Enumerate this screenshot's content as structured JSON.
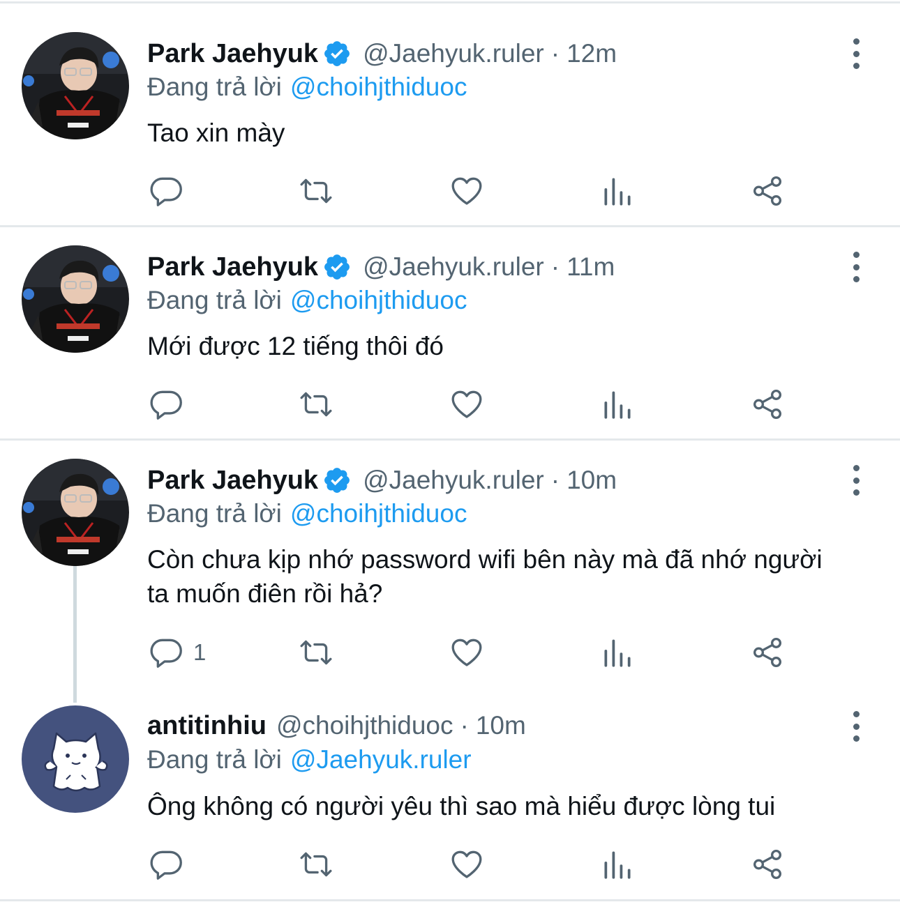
{
  "tweets": [
    {
      "name": "Park Jaehyuk",
      "verified": true,
      "handle": "@Jaehyuk.ruler",
      "dot": "·",
      "time": "12m",
      "reply_prefix": "Đang trả lời",
      "reply_to": "@choihjthiduoc",
      "text": "Tao xin mày",
      "reply_count": ""
    },
    {
      "name": "Park Jaehyuk",
      "verified": true,
      "handle": "@Jaehyuk.ruler",
      "dot": "·",
      "time": "11m",
      "reply_prefix": "Đang trả lời",
      "reply_to": "@choihjthiduoc",
      "text": "Mới được 12 tiếng thôi đó",
      "reply_count": ""
    },
    {
      "name": "Park Jaehyuk",
      "verified": true,
      "handle": "@Jaehyuk.ruler",
      "dot": "·",
      "time": "10m",
      "reply_prefix": "Đang trả lời",
      "reply_to": "@choihjthiduoc",
      "text": "Còn chưa kịp nhớ password wifi bên này mà đã nhớ người ta muốn điên rồi hả?",
      "reply_count": "1"
    },
    {
      "name": "antitinhiu",
      "verified": false,
      "handle": "@choihjthiduoc",
      "dot": "·",
      "time": "10m",
      "reply_prefix": "Đang trả lời",
      "reply_to": "@Jaehyuk.ruler",
      "text": "Ông không có người yêu thì sao mà hiểu được lòng tui",
      "reply_count": ""
    }
  ],
  "icons": {
    "reply": "reply-icon",
    "retweet": "retweet-icon",
    "like": "heart-icon",
    "views": "views-icon",
    "share": "share-icon",
    "more": "more-vertical-icon",
    "verified": "verified-badge-icon"
  },
  "colors": {
    "text": "#0f1419",
    "secondary": "#536471",
    "link": "#1d9bf0",
    "divider": "#e4e8eb",
    "thread_line": "#cfd9de",
    "cat_avatar_bg": "#44527e"
  }
}
